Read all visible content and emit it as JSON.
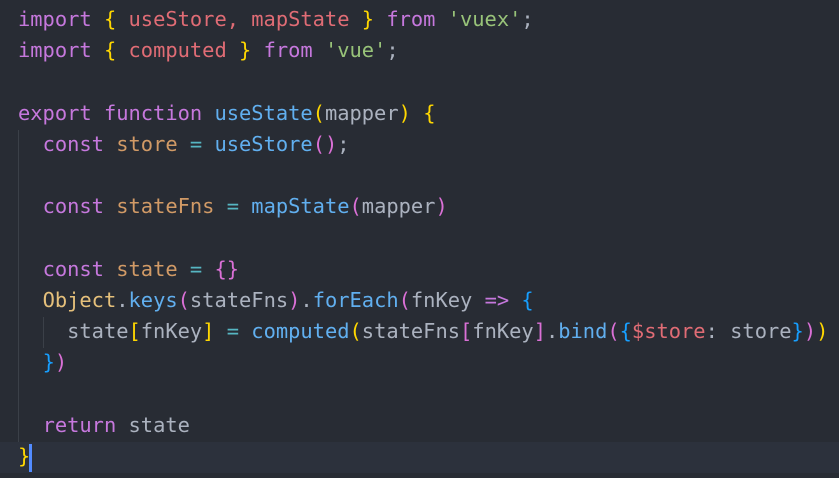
{
  "editor": {
    "colors": {
      "background": "#282c34",
      "keyword": "#c678dd",
      "string": "#98c379",
      "function": "#61afef"
    },
    "lines": [
      [
        [
          "import",
          "kw"
        ],
        [
          " ",
          "txt"
        ],
        [
          "{",
          "b1"
        ],
        [
          " useStore, mapState ",
          "imp"
        ],
        [
          "}",
          "b1"
        ],
        [
          " ",
          "txt"
        ],
        [
          "from",
          "kw"
        ],
        [
          " ",
          "txt"
        ],
        [
          "'vuex'",
          "str"
        ],
        [
          ";",
          "txt"
        ]
      ],
      [
        [
          "import",
          "kw"
        ],
        [
          " ",
          "txt"
        ],
        [
          "{",
          "b1"
        ],
        [
          " computed ",
          "imp"
        ],
        [
          "}",
          "b1"
        ],
        [
          " ",
          "txt"
        ],
        [
          "from",
          "kw"
        ],
        [
          " ",
          "txt"
        ],
        [
          "'vue'",
          "str"
        ],
        [
          ";",
          "txt"
        ]
      ],
      [],
      [
        [
          "export",
          "kw"
        ],
        [
          " ",
          "txt"
        ],
        [
          "function",
          "kw"
        ],
        [
          " ",
          "txt"
        ],
        [
          "useState",
          "fn"
        ],
        [
          "(",
          "b1"
        ],
        [
          "mapper",
          "txt"
        ],
        [
          ")",
          "b1"
        ],
        [
          " ",
          "txt"
        ],
        [
          "{",
          "b1"
        ]
      ],
      [
        [
          "  ",
          "txt"
        ],
        [
          "const",
          "kw"
        ],
        [
          " ",
          "txt"
        ],
        [
          "store",
          "cn"
        ],
        [
          " ",
          "txt"
        ],
        [
          "=",
          "op"
        ],
        [
          " ",
          "txt"
        ],
        [
          "useStore",
          "fn"
        ],
        [
          "()",
          "b2"
        ],
        [
          ";",
          "txt"
        ]
      ],
      [],
      [
        [
          "  ",
          "txt"
        ],
        [
          "const",
          "kw"
        ],
        [
          " ",
          "txt"
        ],
        [
          "stateFns",
          "cn"
        ],
        [
          " ",
          "txt"
        ],
        [
          "=",
          "op"
        ],
        [
          " ",
          "txt"
        ],
        [
          "mapState",
          "fn"
        ],
        [
          "(",
          "b2"
        ],
        [
          "mapper",
          "txt"
        ],
        [
          ")",
          "b2"
        ]
      ],
      [],
      [
        [
          "  ",
          "txt"
        ],
        [
          "const",
          "kw"
        ],
        [
          " ",
          "txt"
        ],
        [
          "state",
          "cn"
        ],
        [
          " ",
          "txt"
        ],
        [
          "=",
          "op"
        ],
        [
          " ",
          "txt"
        ],
        [
          "{}",
          "b2"
        ]
      ],
      [
        [
          "  ",
          "txt"
        ],
        [
          "Object",
          "cls"
        ],
        [
          ".",
          "txt"
        ],
        [
          "keys",
          "fn"
        ],
        [
          "(",
          "b2"
        ],
        [
          "stateFns",
          "txt"
        ],
        [
          ")",
          "b2"
        ],
        [
          ".",
          "txt"
        ],
        [
          "forEach",
          "fn"
        ],
        [
          "(",
          "b2"
        ],
        [
          "fnKey",
          "txt"
        ],
        [
          " ",
          "txt"
        ],
        [
          "=>",
          "kw"
        ],
        [
          " ",
          "txt"
        ],
        [
          "{",
          "b3"
        ]
      ],
      [
        [
          "    ",
          "txt"
        ],
        [
          "state",
          "txt"
        ],
        [
          "[",
          "b1"
        ],
        [
          "fnKey",
          "txt"
        ],
        [
          "]",
          "b1"
        ],
        [
          " ",
          "txt"
        ],
        [
          "=",
          "op"
        ],
        [
          " ",
          "txt"
        ],
        [
          "computed",
          "fn"
        ],
        [
          "(",
          "b1"
        ],
        [
          "stateFns",
          "txt"
        ],
        [
          "[",
          "b2"
        ],
        [
          "fnKey",
          "txt"
        ],
        [
          "]",
          "b2"
        ],
        [
          ".",
          "txt"
        ],
        [
          "bind",
          "fn"
        ],
        [
          "(",
          "b2"
        ],
        [
          "{",
          "b3"
        ],
        [
          "$store",
          "prop"
        ],
        [
          ":",
          "txt"
        ],
        [
          " store",
          "txt"
        ],
        [
          "}",
          "b3"
        ],
        [
          ")",
          "b2"
        ],
        [
          ")",
          "b1"
        ]
      ],
      [
        [
          "  ",
          "txt"
        ],
        [
          "}",
          "b3"
        ],
        [
          ")",
          "b2"
        ]
      ],
      [],
      [
        [
          "  ",
          "txt"
        ],
        [
          "return",
          "kw"
        ],
        [
          " state",
          "txt"
        ]
      ],
      [
        [
          "}",
          "b1"
        ]
      ]
    ]
  }
}
